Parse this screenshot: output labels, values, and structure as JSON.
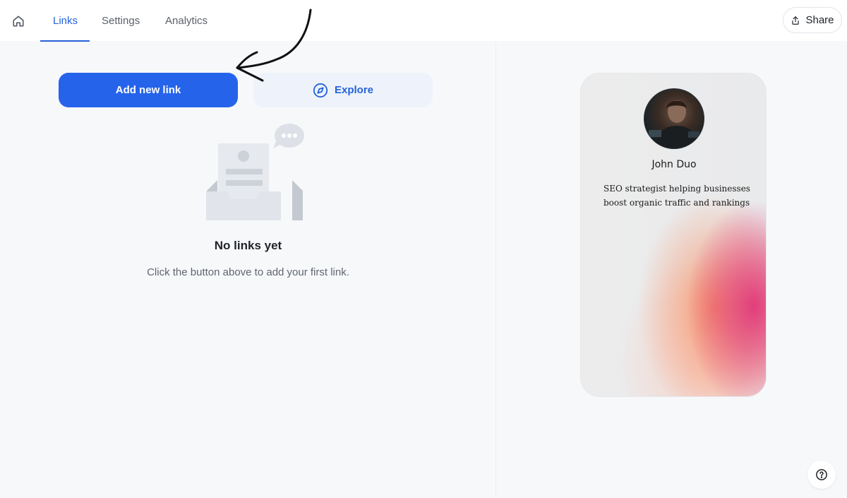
{
  "nav": {
    "tabs": [
      {
        "label": "Links",
        "active": true
      },
      {
        "label": "Settings",
        "active": false
      },
      {
        "label": "Analytics",
        "active": false
      }
    ],
    "home_icon": "home-icon",
    "share_label": "Share",
    "share_icon": "share-icon"
  },
  "actions": {
    "add_label": "Add new link",
    "explore_label": "Explore",
    "explore_icon": "compass-icon"
  },
  "empty_state": {
    "title": "No links yet",
    "subtitle": "Click the button above to add your first link."
  },
  "preview": {
    "name": "John Duo",
    "bio_line1": "SEO strategist helping businesses",
    "bio_line2": "boost organic traffic and rankings"
  },
  "colors": {
    "accent": "#2563eb",
    "explore_bg": "#eef3fb",
    "page_bg": "#f7f8fa"
  },
  "help_icon": "help-circle-icon"
}
